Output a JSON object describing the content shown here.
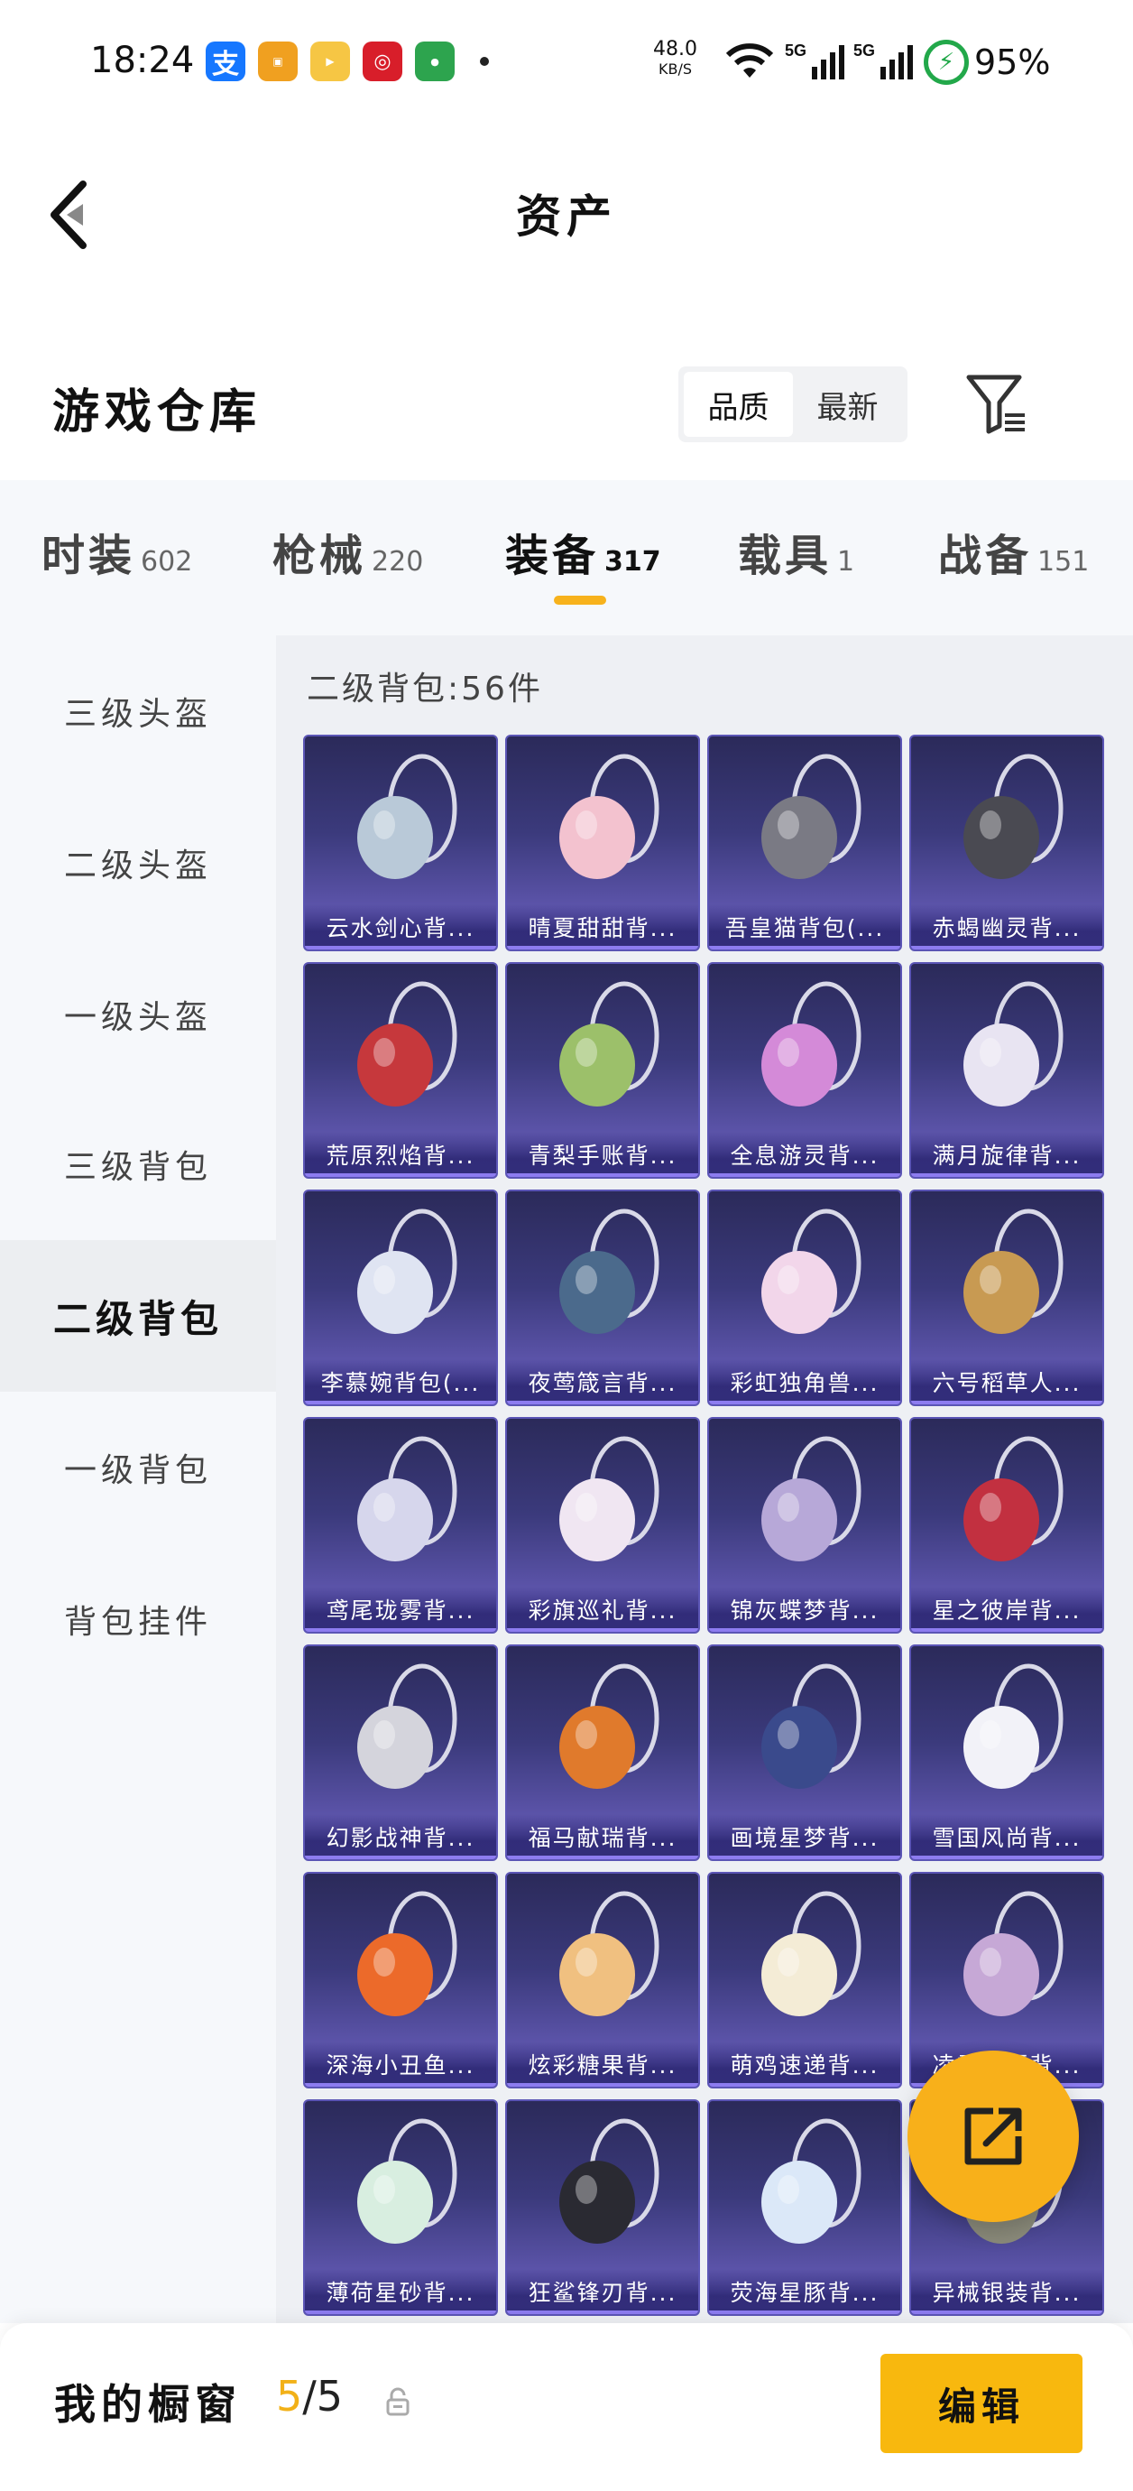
{
  "status_bar": {
    "time": "18:24",
    "net_speed_value": "48.0",
    "net_speed_unit": "KB/S",
    "signal_1": "5G",
    "signal_2": "5G",
    "battery": "95%",
    "notif_icons": [
      "alipay-icon",
      "app-icon",
      "video-app-icon",
      "bank-icon",
      "oppo-icon"
    ]
  },
  "header": {
    "title": "资产",
    "back_icon": "chevron-left-icon"
  },
  "warehouse": {
    "title": "游戏仓库",
    "sort_options": [
      "品质",
      "最新"
    ],
    "active_sort": "品质",
    "filter_icon": "filter-icon"
  },
  "tabs": [
    {
      "label": "时装",
      "count": "602"
    },
    {
      "label": "枪械",
      "count": "220"
    },
    {
      "label": "装备",
      "count": "317",
      "active": true
    },
    {
      "label": "载具",
      "count": "1"
    },
    {
      "label": "战备",
      "count": "151"
    }
  ],
  "sidebar": {
    "items": [
      "三级头盔",
      "二级头盔",
      "一级头盔",
      "三级背包",
      "二级背包",
      "一级背包",
      "背包挂件"
    ],
    "active": "二级背包"
  },
  "content": {
    "section_title": "二级背包:56件",
    "items": [
      {
        "name": "云水剑心背...",
        "color": "#b9c9d8"
      },
      {
        "name": "晴夏甜甜背...",
        "color": "#f3c2cf"
      },
      {
        "name": "吾皇猫背包(...",
        "color": "#7a7a84"
      },
      {
        "name": "赤蝎幽灵背...",
        "color": "#4a4a52"
      },
      {
        "name": "荒原烈焰背...",
        "color": "#c6383c"
      },
      {
        "name": "青梨手账背...",
        "color": "#9cc06a"
      },
      {
        "name": "全息游灵背...",
        "color": "#d48ad8"
      },
      {
        "name": "满月旋律背...",
        "color": "#e8e4f2"
      },
      {
        "name": "李慕婉背包(...",
        "color": "#dfe4f2"
      },
      {
        "name": "夜莺箴言背...",
        "color": "#4b6a8c"
      },
      {
        "name": "彩虹独角兽...",
        "color": "#f2d6ea"
      },
      {
        "name": "六号稻草人...",
        "color": "#c89a52"
      },
      {
        "name": "鸢尾珑雾背...",
        "color": "#d6d6ec"
      },
      {
        "name": "彩旗巡礼背...",
        "color": "#f0e6f2"
      },
      {
        "name": "锦灰蝶梦背...",
        "color": "#b7a8d8"
      },
      {
        "name": "星之彼岸背...",
        "color": "#c23040"
      },
      {
        "name": "幻影战神背...",
        "color": "#d4d4dc"
      },
      {
        "name": "福马献瑞背...",
        "color": "#e07a2c"
      },
      {
        "name": "画境星梦背...",
        "color": "#3a4a8c"
      },
      {
        "name": "雪国风尚背...",
        "color": "#f2f2f8"
      },
      {
        "name": "深海小丑鱼...",
        "color": "#ec6a2a"
      },
      {
        "name": "炫彩糖果背...",
        "color": "#f0c080"
      },
      {
        "name": "萌鸡速递背...",
        "color": "#f4ecd6"
      },
      {
        "name": "凌霜花语背...",
        "color": "#c6a8d6"
      },
      {
        "name": "薄荷星砂背...",
        "color": "#d8eee0"
      },
      {
        "name": "狂鲨锋刃背...",
        "color": "#2a2a32"
      },
      {
        "name": "荧海星豚背...",
        "color": "#dbe8f8"
      },
      {
        "name": "异械银装背...",
        "color": "#8a8a7a"
      }
    ]
  },
  "fab": {
    "icon": "share-external-icon"
  },
  "bottom": {
    "window_label": "我的橱窗",
    "count_current": "5",
    "count_sep": "/",
    "count_total": "5",
    "lock_icon": "lock-icon",
    "edit_label": "编辑"
  },
  "colors": {
    "accent": "#f8b80e",
    "indicator": "#f7b21c",
    "card_bg_top": "#2b2a5a",
    "card_bg_bottom": "#6f63c4"
  }
}
